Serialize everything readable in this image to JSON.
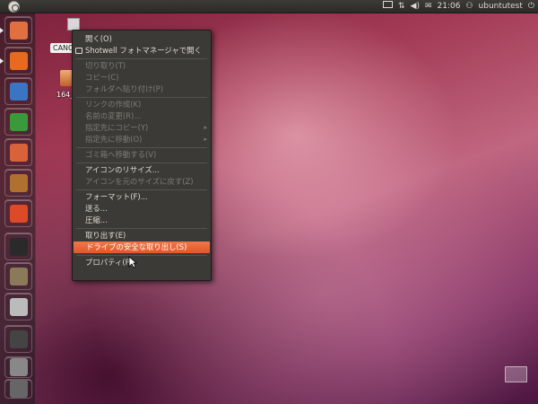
{
  "top_panel": {
    "time": "21:06",
    "user": "ubuntutest"
  },
  "desktop": {
    "icons": [
      {
        "label": "CANC",
        "icon": "usb-drive-icon"
      },
      {
        "label": "164_",
        "icon": "folder-icon"
      }
    ]
  },
  "launcher": {
    "items": [
      {
        "name": "home-folder",
        "icon": "home-folder-icon",
        "color": "#e07040"
      },
      {
        "name": "firefox",
        "icon": "firefox-icon",
        "color": "#e66a20"
      },
      {
        "name": "writer",
        "icon": "libreoffice-writer-icon",
        "color": "#3c74c4"
      },
      {
        "name": "calc",
        "icon": "libreoffice-calc-icon",
        "color": "#3a9a3a"
      },
      {
        "name": "impress",
        "icon": "libreoffice-impress-icon",
        "color": "#d8623a"
      },
      {
        "name": "software-center",
        "icon": "ubuntu-software-center-icon",
        "color": "#b07030"
      },
      {
        "name": "ubuntu-one",
        "icon": "ubuntu-one-icon",
        "color": "#dc4a28"
      },
      {
        "name": "terminal",
        "icon": "terminal-icon",
        "color": "#2a2a2a"
      },
      {
        "name": "gimp",
        "icon": "gimp-icon",
        "color": "#8a7a5a"
      },
      {
        "name": "screenshot",
        "icon": "camera-icon",
        "color": "#bbbbbb"
      },
      {
        "name": "workspace",
        "icon": "workspace-icon",
        "color": "#444444"
      },
      {
        "name": "usb-drive",
        "icon": "usb-drive-icon",
        "color": "#888888"
      },
      {
        "name": "trash",
        "icon": "trash-icon",
        "color": "#666666"
      }
    ]
  },
  "context_menu": {
    "items": [
      {
        "label": "開く(O)",
        "enabled": true
      },
      {
        "label": "Shotwell フォトマネージャで開く",
        "enabled": true,
        "icon": "shotwell-icon"
      },
      {
        "sep": true
      },
      {
        "label": "切り取り(T)",
        "enabled": false
      },
      {
        "label": "コピー(C)",
        "enabled": false
      },
      {
        "label": "フォルダへ貼り付け(P)",
        "enabled": false
      },
      {
        "sep": true
      },
      {
        "label": "リンクの作成(K)",
        "enabled": false
      },
      {
        "label": "名前の変更(R)...",
        "enabled": false
      },
      {
        "label": "指定先にコピー(Y)",
        "enabled": false,
        "submenu": true
      },
      {
        "label": "指定先に移動(O)",
        "enabled": false,
        "submenu": true
      },
      {
        "sep": true
      },
      {
        "label": "ゴミ箱へ移動する(V)",
        "enabled": false
      },
      {
        "sep": true
      },
      {
        "label": "アイコンのリサイズ...",
        "enabled": true
      },
      {
        "label": "アイコンを元のサイズに戻す(Z)",
        "enabled": false
      },
      {
        "sep": true
      },
      {
        "label": "フォーマット(F)...",
        "enabled": true
      },
      {
        "label": "送る...",
        "enabled": true
      },
      {
        "label": "圧縮...",
        "enabled": true
      },
      {
        "sep": true
      },
      {
        "label": "取り出す(E)",
        "enabled": true
      },
      {
        "label": "ドライブの安全な取り出し(S)",
        "enabled": true,
        "highlighted": true
      },
      {
        "sep": true
      },
      {
        "label": "プロパティ(P)",
        "enabled": true
      }
    ]
  }
}
